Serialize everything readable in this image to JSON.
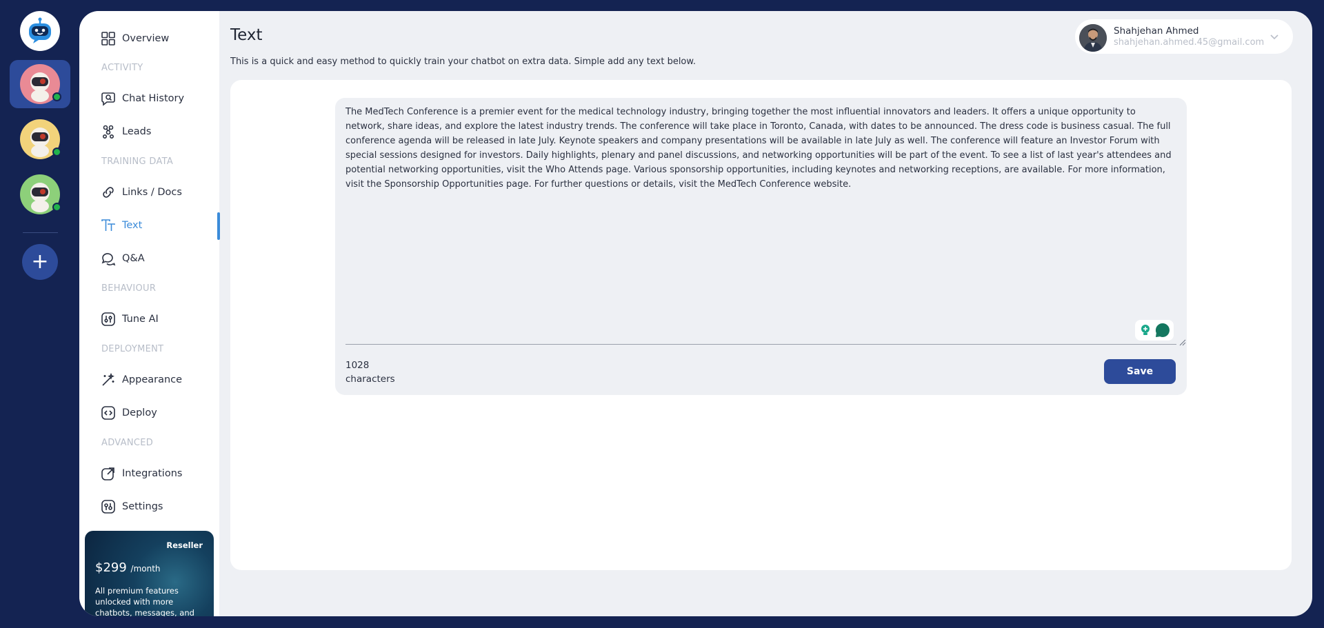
{
  "rail": {
    "bots": [
      {
        "name": "bot-pink",
        "color": "#e98a95",
        "status": "online"
      },
      {
        "name": "bot-yellow",
        "color": "#f2d37b",
        "status": "online"
      },
      {
        "name": "bot-green",
        "color": "#8dd07a",
        "status": "online"
      }
    ],
    "add_label": "+"
  },
  "nav": {
    "overview": "Overview",
    "section_activity": "ACTIVITY",
    "chat_history": "Chat History",
    "leads": "Leads",
    "section_training": "TRAINING DATA",
    "links_docs": "Links / Docs",
    "text": "Text",
    "qa": "Q&A",
    "section_behaviour": "BEHAVIOUR",
    "tune_ai": "Tune AI",
    "section_deployment": "DEPLOYMENT",
    "appearance": "Appearance",
    "deploy": "Deploy",
    "section_advanced": "ADVANCED",
    "integrations": "Integrations",
    "settings": "Settings"
  },
  "promo": {
    "tag": "Reseller",
    "price": "$299",
    "period": "/month",
    "description": "All premium features unlocked with more chatbots, messages, and"
  },
  "header": {
    "title": "Text",
    "subtitle": "This is a quick and easy method to quickly train your chatbot on extra data. Simple add any text below."
  },
  "user": {
    "name": "Shahjehan Ahmed",
    "email": "shahjehan.ahmed.45@gmail.com"
  },
  "editor": {
    "text": "The MedTech Conference is a premier event for the medical technology industry, bringing together the most influential innovators and leaders. It offers a unique opportunity to network, share ideas, and explore the latest industry trends. The conference will take place in Toronto, Canada, with dates to be announced. The dress code is business casual. The full conference agenda will be released in late July. Keynote speakers and company presentations will be available in late July as well. The conference will feature an Investor Forum with special sessions designed for investors. Daily highlights, plenary and panel discussions, and networking opportunities will be part of the event. To see a list of last year's attendees and potential networking opportunities, visit the Who Attends page. Various sponsorship opportunities, including keynotes and networking receptions, are available. For more information, visit the Sponsorship Opportunities page. For further questions or details, visit the MedTech Conference website.",
    "char_count": "1028",
    "char_label": "characters",
    "save_label": "Save"
  },
  "colors": {
    "accent": "#2d4b9a",
    "active_nav": "#3b8bd9",
    "background": "#142352"
  }
}
